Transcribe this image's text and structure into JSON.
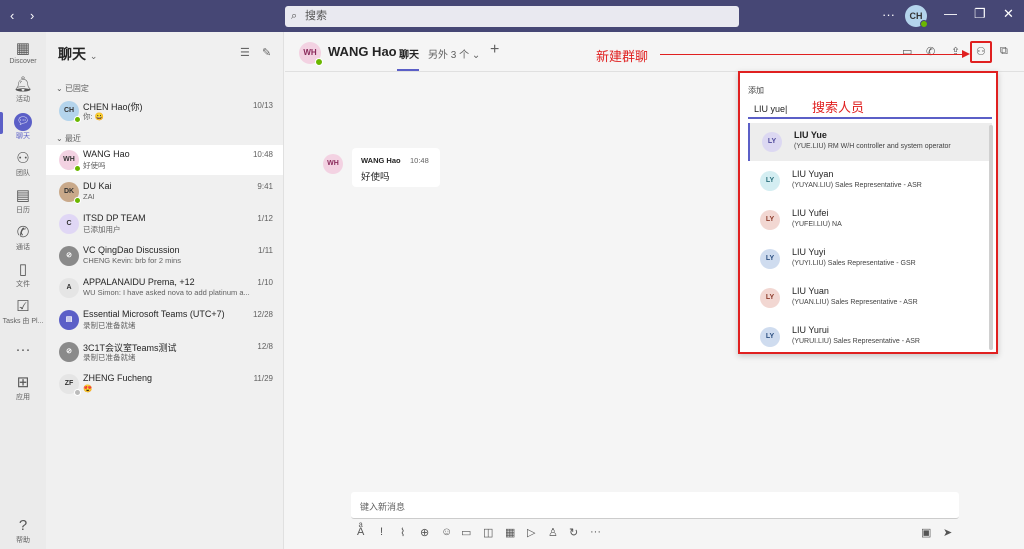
{
  "titlebar": {
    "back": "‹",
    "forward": "›",
    "search_placeholder": "搜索",
    "more": "···",
    "avatar": "CH",
    "minimize": "—",
    "restore": "❐",
    "close": "✕"
  },
  "rail": [
    {
      "id": "discover",
      "label": "Discover",
      "icon": "▦"
    },
    {
      "id": "activity",
      "label": "活动",
      "icon": "🔔︎"
    },
    {
      "id": "chat",
      "label": "聊天",
      "icon": "💬︎"
    },
    {
      "id": "teams",
      "label": "团队",
      "icon": "⚇"
    },
    {
      "id": "calendar",
      "label": "日历",
      "icon": "▤"
    },
    {
      "id": "calls",
      "label": "通话",
      "icon": "✆"
    },
    {
      "id": "files",
      "label": "文件",
      "icon": "▯"
    },
    {
      "id": "tasks",
      "label": "Tasks 由 Pl...",
      "icon": "☑"
    },
    {
      "id": "more",
      "label": "",
      "icon": "···"
    },
    {
      "id": "apps",
      "label": "应用",
      "icon": "⊞"
    },
    {
      "id": "help",
      "label": "帮助",
      "icon": "?"
    }
  ],
  "chatlist": {
    "title": "聊天",
    "pinned_label": "已固定",
    "recent_label": "最近",
    "pinned": [
      {
        "initials": "CH",
        "name": "CHEN Hao(你)",
        "preview": "你: 😀",
        "time": "10/13",
        "avatar_bg": "#b4d4ec",
        "status": "#6bb700"
      }
    ],
    "recent": [
      {
        "initials": "WH",
        "name": "WANG Hao",
        "preview": "好使吗",
        "time": "10:48",
        "avatar_bg": "#f3d2e2",
        "status": "#6bb700"
      },
      {
        "initials": "DK",
        "name": "DU Kai",
        "preview": "ZAI",
        "time": "9:41",
        "avatar_bg": "#c9a98a",
        "status": "#6bb700"
      },
      {
        "initials": "C",
        "name": "ITSD DP TEAM",
        "preview": "已添加用户",
        "time": "1/12",
        "avatar_bg": "#e0d7f5",
        "status": ""
      },
      {
        "initials": "⊘",
        "name": "VC QingDao Discussion",
        "preview": "CHENG Kevin: brb for 2 mins",
        "time": "1/11",
        "avatar_bg": "#8a8a8a",
        "status": ""
      },
      {
        "initials": "A",
        "name": "APPALANAIDU Prema, +12",
        "preview": "WU Simon: I have asked nova to add platinum a...",
        "time": "1/10",
        "avatar_bg": "#e5e5e5",
        "status": ""
      },
      {
        "initials": "▤",
        "name": "Essential Microsoft Teams (UTC+7)",
        "preview": "录制已准备就绪",
        "time": "12/28",
        "avatar_bg": "#5b5fc7",
        "status": ""
      },
      {
        "initials": "⊘",
        "name": "3C1T会议室Teams测试",
        "preview": "录制已准备就绪",
        "time": "12/8",
        "avatar_bg": "#8a8a8a",
        "status": ""
      },
      {
        "initials": "ZF",
        "name": "ZHENG Fucheng",
        "preview": "😍",
        "time": "11/29",
        "avatar_bg": "#e5e5e5",
        "status": "#bbb"
      }
    ]
  },
  "conversation": {
    "avatar": "WH",
    "name": "WANG Hao",
    "tab": "聊天",
    "more_tabs": "另外 3 个",
    "add_tab": "+",
    "annotation_new_group": "新建群聊",
    "message": {
      "sender": "WANG Hao",
      "time": "10:48",
      "text": "好使吗"
    },
    "compose_placeholder": "键入新消息"
  },
  "add_panel": {
    "label": "添加",
    "input_value": "LIU yue",
    "annotation_search": "搜索人员",
    "results": [
      {
        "initials": "LY",
        "name": "LIU Yue",
        "detail": "(YUE.LIU) RM W/H controller and system operator",
        "avatar_bg": "#dcd8f2",
        "avatar_fg": "#4f4a9c"
      },
      {
        "initials": "LY",
        "name": "LIU Yuyan",
        "detail": "(YUYAN.LIU) Sales Representative - ASR",
        "avatar_bg": "#d4eef2",
        "avatar_fg": "#2a6f7c"
      },
      {
        "initials": "LY",
        "name": "LIU Yufei",
        "detail": "(YUFEI.LIU) NA",
        "avatar_bg": "#f2d7d2",
        "avatar_fg": "#8c3a2a"
      },
      {
        "initials": "LY",
        "name": "LIU Yuyi",
        "detail": "(YUYI.LIU) Sales Representative - GSR",
        "avatar_bg": "#cfdcef",
        "avatar_fg": "#2c4f80"
      },
      {
        "initials": "LY",
        "name": "LIU Yuan",
        "detail": "(YUAN.LIU) Sales Representative - ASR",
        "avatar_bg": "#f2d7d2",
        "avatar_fg": "#8c3a2a"
      },
      {
        "initials": "LY",
        "name": "LIU Yurui",
        "detail": "(YURUI.LIU) Sales Representative - ASR",
        "avatar_bg": "#cfdcef",
        "avatar_fg": "#2c4f80"
      }
    ]
  },
  "colors": {
    "accent": "#5b5fc7",
    "titlebar": "#464775",
    "annotation": "#e02020"
  }
}
